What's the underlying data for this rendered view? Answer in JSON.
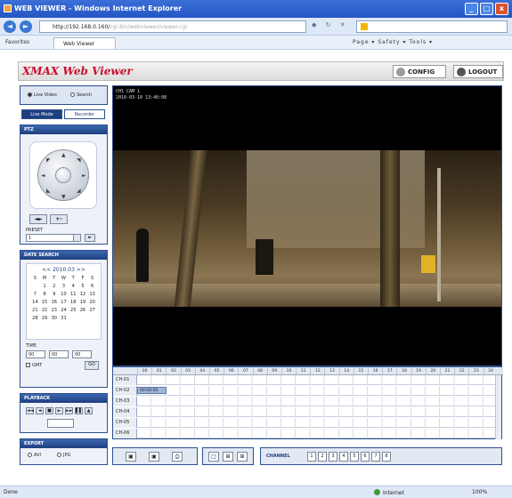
{
  "window": {
    "title": "WEB VIEWER - Windows Internet Explorer",
    "controls": [
      "_",
      "□",
      "x"
    ]
  },
  "address_bar": {
    "url": "http://192.168.0.160/",
    "url_suffix": "cgi-bin/webviewer/viewer.cgi",
    "back": "◄",
    "forward": "►"
  },
  "favorites_bar": {
    "favorites_label": "Favorites",
    "tab_label": "Web Viewer",
    "tools": "Page ▾  Safety ▾  Tools ▾"
  },
  "header": {
    "logo_brand": "XMAX",
    "logo_product": "Web Viewer",
    "config_label": "CONFIG",
    "logout_label": "LOGOUT"
  },
  "mode": {
    "live_label": "Live Video",
    "search_label": "Search"
  },
  "tabs": {
    "live": "Live Mode",
    "record": "Recorder"
  },
  "ptz": {
    "title": "PTZ",
    "buttons": [
      "◄",
      "►",
      "+",
      "-"
    ],
    "preset_label": "PRESET",
    "preset_value": "1"
  },
  "search": {
    "title": "DATE SEARCH",
    "month_title": "<< 2010.03 >>",
    "weekdays": [
      "S",
      "M",
      "T",
      "W",
      "T",
      "F",
      "S"
    ],
    "days": [
      "",
      "1",
      "2",
      "3",
      "4",
      "5",
      "6",
      "7",
      "8",
      "9",
      "10",
      "11",
      "12",
      "13",
      "14",
      "15",
      "16",
      "17",
      "18",
      "19",
      "20",
      "21",
      "22",
      "23",
      "24",
      "25",
      "26",
      "27",
      "28",
      "29",
      "30",
      "31"
    ],
    "time_label": "TIME",
    "time_values": [
      "00",
      "00",
      "00"
    ],
    "gmt_label": "GMT",
    "go_label": "GO"
  },
  "playback": {
    "title": "PLAYBACK",
    "buttons": [
      "◄◄",
      "◄",
      "■",
      "►",
      "►►",
      "▌▌",
      "▲"
    ]
  },
  "download": {
    "title": "EXPORT",
    "option1": "AVI",
    "option2": "JPG"
  },
  "video": {
    "osd_line1": "CH1 CAM 1",
    "osd_line2": "2010-03-10 13:40:08"
  },
  "timeline": {
    "hours": [
      "00",
      "01",
      "02",
      "03",
      "04",
      "05",
      "06",
      "07",
      "08",
      "09",
      "10",
      "11",
      "12",
      "13",
      "14",
      "15",
      "16",
      "17",
      "18",
      "19",
      "20",
      "21",
      "22",
      "23",
      "24"
    ],
    "channels": [
      "CH-01",
      "CH-02",
      "CH-03",
      "CH-04",
      "CH-05",
      "CH-06"
    ],
    "record_label": "00:00:00"
  },
  "bottom": {
    "channel_label": "CHANNEL",
    "channel_buttons": [
      "1",
      "2",
      "3",
      "4",
      "5",
      "6",
      "7",
      "8"
    ],
    "split_buttons": [
      "□",
      "⊞",
      "⊞"
    ]
  },
  "status_bar": {
    "left": "Done",
    "zone": "Internet",
    "zoom": "100%"
  }
}
